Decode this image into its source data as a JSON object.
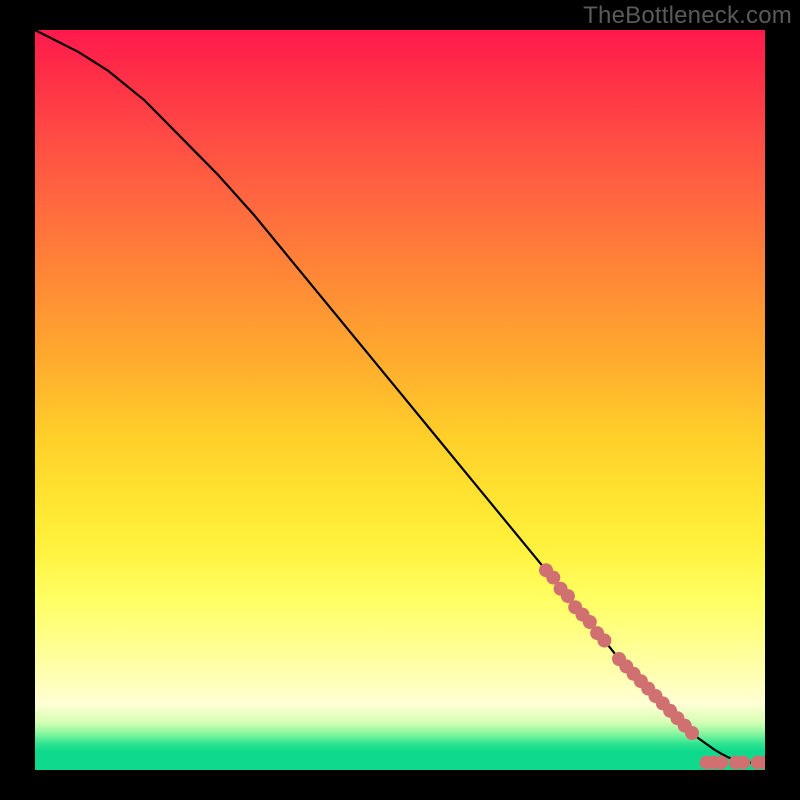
{
  "watermark": "TheBottleneck.com",
  "chart_data": {
    "type": "line",
    "title": "",
    "xlabel": "",
    "ylabel": "",
    "xlim": [
      0,
      100
    ],
    "ylim": [
      0,
      100
    ],
    "grid": false,
    "series": [
      {
        "name": "bottleneck-curve",
        "x": [
          0,
          3,
          6,
          10,
          15,
          20,
          25,
          30,
          35,
          40,
          45,
          50,
          55,
          60,
          65,
          70,
          75,
          78,
          80,
          82,
          84,
          86,
          88,
          90,
          91,
          92,
          93,
          94,
          95,
          96,
          97,
          98,
          99,
          100
        ],
        "values": [
          100,
          98.5,
          97,
          94.5,
          90.5,
          85.5,
          80.5,
          75,
          69,
          63,
          57,
          51,
          45,
          39,
          33,
          27,
          21,
          17.5,
          15,
          13,
          11,
          9,
          7,
          5,
          4.2,
          3.5,
          2.8,
          2.2,
          1.7,
          1.3,
          1.0,
          1.0,
          1.0,
          1.0
        ]
      }
    ],
    "markers": [
      {
        "name": "highlighted-points",
        "color": "#d07070",
        "x": [
          70,
          71,
          72,
          73,
          74,
          75,
          76,
          77,
          78,
          80,
          81,
          82,
          83,
          84,
          85,
          86,
          87,
          88,
          89,
          90,
          92,
          93,
          94,
          96,
          97,
          99,
          100
        ],
        "values": [
          27,
          26,
          24.5,
          23.5,
          22,
          21,
          20,
          18.5,
          17.5,
          15,
          14,
          13,
          12,
          11,
          10,
          9,
          8,
          7,
          6,
          5,
          1.0,
          1.0,
          1.0,
          1.0,
          1.0,
          1.0,
          1.0
        ]
      }
    ]
  }
}
